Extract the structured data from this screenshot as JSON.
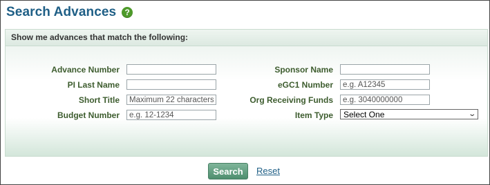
{
  "page": {
    "title": "Search Advances",
    "help_icon": "question-icon"
  },
  "panel": {
    "header": "Show me advances that match the following:"
  },
  "fields": {
    "advance_number": {
      "label": "Advance Number",
      "value": "",
      "placeholder": ""
    },
    "pi_last_name": {
      "label": "PI Last Name",
      "value": "",
      "placeholder": ""
    },
    "short_title": {
      "label": "Short Title",
      "value": "",
      "placeholder": "Maximum 22 characters"
    },
    "budget_number": {
      "label": "Budget Number",
      "value": "",
      "placeholder": "e.g. 12-1234"
    },
    "sponsor_name": {
      "label": "Sponsor Name",
      "value": "",
      "placeholder": ""
    },
    "egc1_number": {
      "label": "eGC1 Number",
      "value": "",
      "placeholder": "e.g. A12345"
    },
    "org_receiving_funds": {
      "label": "Org Receiving Funds",
      "value": "",
      "placeholder": "e.g. 3040000000"
    },
    "item_type": {
      "label": "Item Type",
      "selected": "Select One"
    }
  },
  "actions": {
    "search_label": "Search",
    "reset_label": "Reset"
  },
  "colors": {
    "title": "#1f5f86",
    "label": "#3d5c2e",
    "button": "#5e9c7e",
    "help_icon": "#4e9a2a"
  }
}
